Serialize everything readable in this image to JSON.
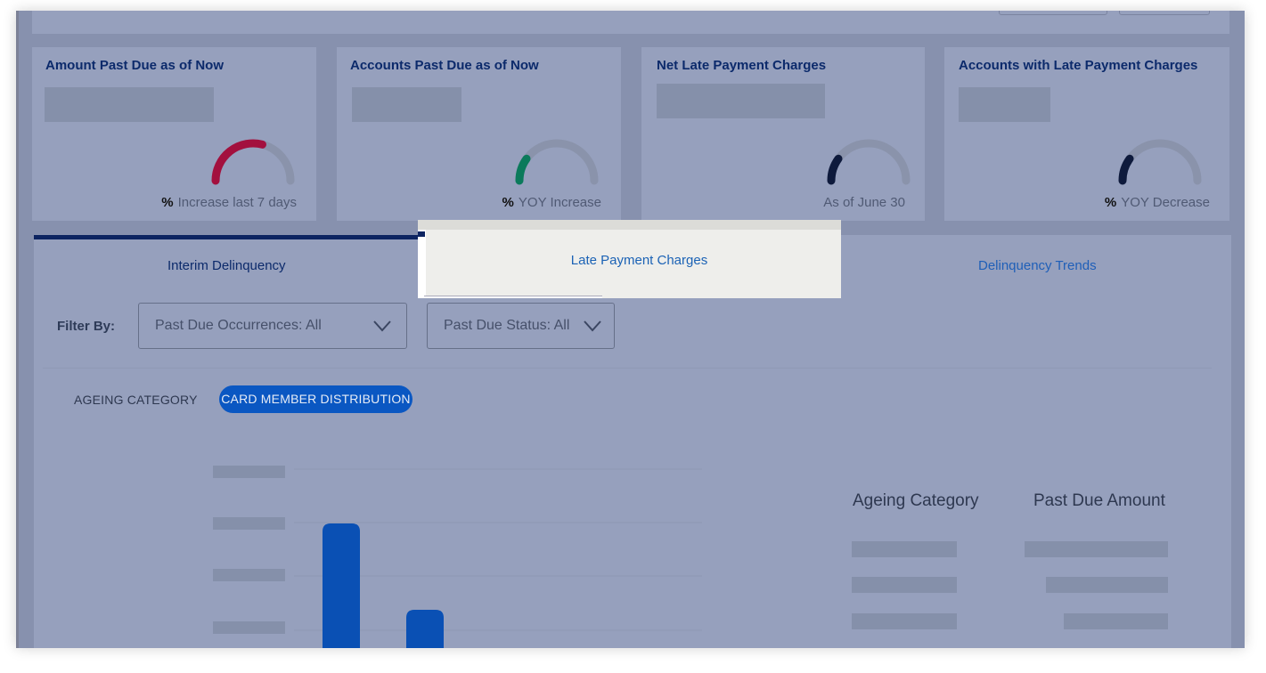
{
  "cards": [
    {
      "title": "Amount Past Due as of Now",
      "foot_prefix": "%",
      "foot_text": "Increase last 7 days",
      "gauge_color": "#a3103e",
      "gauge_fraction": 0.58
    },
    {
      "title": "Accounts Past Due as of Now",
      "foot_prefix": "%",
      "foot_text": "YOY Increase",
      "gauge_color": "#0b7a5b",
      "gauge_fraction": 0.2
    },
    {
      "title": "Net Late Payment Charges",
      "foot_prefix": "",
      "foot_text": "As of June 30",
      "gauge_color": "#0e1a3c",
      "gauge_fraction": 0.2
    },
    {
      "title": "Accounts with Late Payment Charges",
      "foot_prefix": "%",
      "foot_text": "YOY Decrease",
      "gauge_color": "#0e1a3c",
      "gauge_fraction": 0.2
    }
  ],
  "tabs": [
    {
      "label": "Interim Delinquency",
      "active": true
    },
    {
      "label": "Late Payment Charges",
      "active": false
    },
    {
      "label": "Delinquency Trends",
      "active": false
    }
  ],
  "filters": {
    "label": "Filter By:",
    "occurrences": "Past Due Occurrences: All",
    "status": "Past Due Status: All"
  },
  "toggle": {
    "ageing": "AGEING CATEGORY",
    "distribution": "CARD MEMBER DISTRIBUTION"
  },
  "table": {
    "col1": "Ageing Category",
    "col2": "Past Due Amount"
  },
  "popup": {
    "label": "Late Payment Charges"
  },
  "colors": {
    "accent": "#0a57c2",
    "nav": "#0d2461",
    "gauge_track": "#8a93ab"
  }
}
